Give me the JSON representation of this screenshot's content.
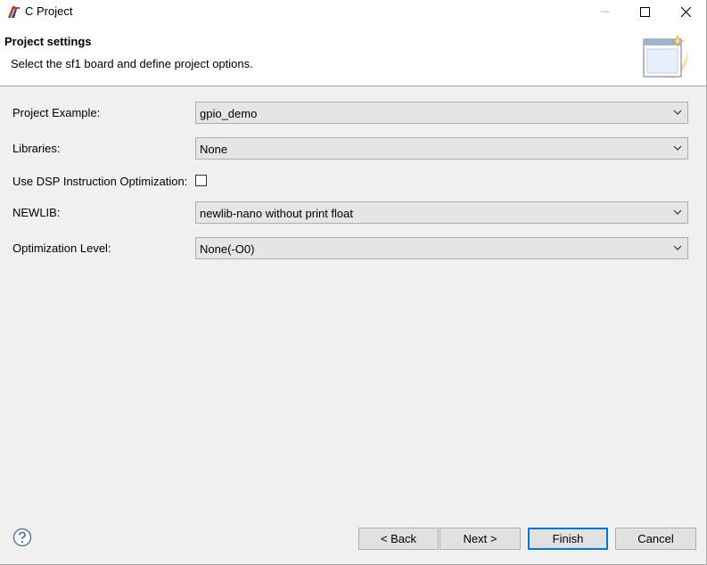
{
  "window": {
    "title": "C Project"
  },
  "header": {
    "title": "Project settings",
    "description": "Select the sf1 board and define project options."
  },
  "form": {
    "project_example": {
      "label": "Project Example:",
      "value": "gpio_demo"
    },
    "libraries": {
      "label": "Libraries:",
      "value": "None"
    },
    "dsp": {
      "label": "Use DSP Instruction Optimization:",
      "checked": false
    },
    "newlib": {
      "label": "NEWLIB:",
      "value": "newlib-nano without print float"
    },
    "optimization": {
      "label": "Optimization Level:",
      "value": "None(-O0)"
    }
  },
  "footer": {
    "back_label": "< Back",
    "next_label": "Next >",
    "finish_label": "Finish",
    "cancel_label": "Cancel"
  },
  "icons": {
    "app": "eclipse-app-icon",
    "help": "help-icon",
    "minimize": "minimize-icon",
    "maximize": "maximize-icon",
    "close": "close-icon",
    "wizard": "wizard-banner-icon"
  },
  "colors": {
    "window_bg": "#f0f0f0",
    "header_bg": "#ffffff",
    "combo_bg": "#e5e5e5",
    "button_bg": "#e1e1e1",
    "default_button_border": "#0078d7"
  }
}
